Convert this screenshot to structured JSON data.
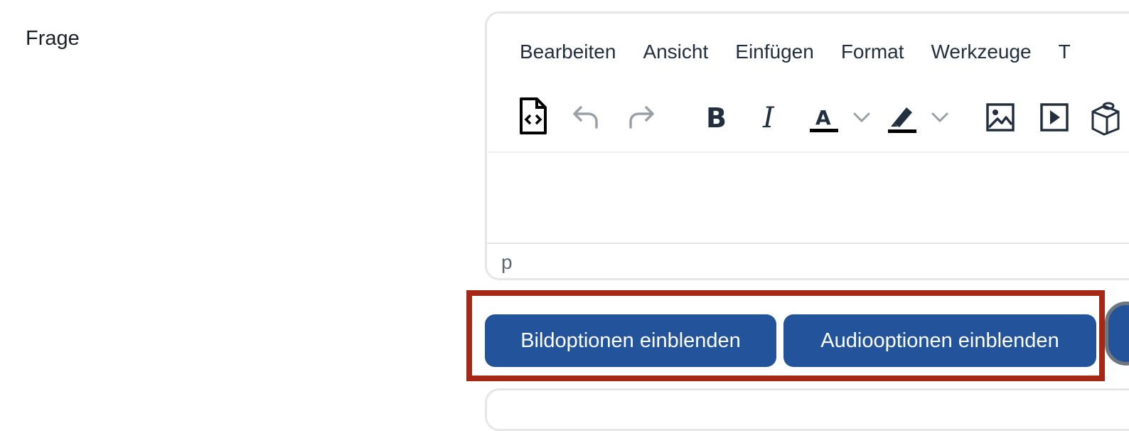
{
  "field": {
    "label": "Frage"
  },
  "editor": {
    "menu": [
      "Bearbeiten",
      "Ansicht",
      "Einfügen",
      "Format",
      "Werkzeuge",
      "T"
    ],
    "toolbar_icons": [
      "html-source-icon",
      "undo-icon",
      "redo-icon",
      "bold-icon",
      "italic-icon",
      "text-color-icon",
      "chevron-down-icon",
      "highlight-color-icon",
      "chevron-down-icon",
      "image-icon",
      "media-icon",
      "h5p-icon"
    ],
    "status_path": "p"
  },
  "buttons": {
    "image_options": "Bildoptionen einblenden",
    "audio_options": "Audiooptionen einblenden"
  },
  "colors": {
    "primary": "#23539b",
    "highlight_border": "#a52714",
    "text": "#1d2125",
    "icon": "#222f3e",
    "icon_disabled": "#9aa0a6"
  }
}
